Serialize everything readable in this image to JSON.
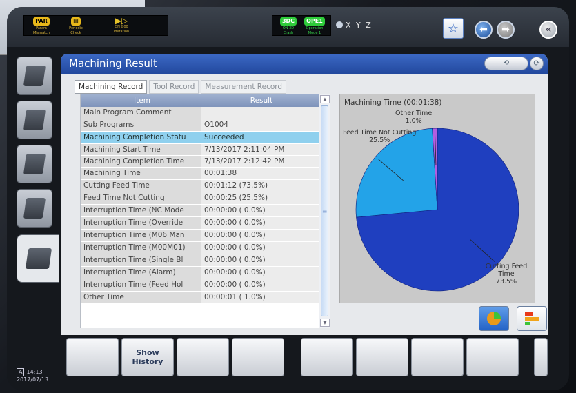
{
  "status_bar": {
    "items": [
      {
        "badge": "PAR",
        "line1": "Param",
        "line2": "Mismatch",
        "color": "#e8b81a"
      },
      {
        "badge": "",
        "line1": "Periodic",
        "line2": "Check",
        "color": "#e8b81a"
      },
      {
        "badge": "",
        "line1": "ON  G00",
        "line2": "Imitation",
        "color": "#e8b81a"
      },
      {
        "badge": "3DC",
        "line1": "ON  3D",
        "line2": "Crash",
        "color": "#2ecc3a"
      },
      {
        "badge": "OPE1",
        "line1": "Operation",
        "line2": "Mode 1",
        "color": "#2ecc3a"
      }
    ],
    "xyz_label": "X Y Z"
  },
  "panel": {
    "title": "Machining Result",
    "tabs": [
      "Machining Record",
      "Tool Record",
      "Measurement Record"
    ],
    "table": {
      "headers": [
        "Item",
        "Result"
      ],
      "rows": [
        {
          "item": "Main Program Comment",
          "result": ""
        },
        {
          "item": "Sub Programs",
          "result": "O1004"
        },
        {
          "item": "Machining Completion Statu",
          "result": "Succeeded",
          "selected": true
        },
        {
          "item": "Machining Start Time",
          "result": "7/13/2017 2:11:04 PM"
        },
        {
          "item": "Machining Completion Time",
          "result": "7/13/2017 2:12:42 PM"
        },
        {
          "item": "Machining Time",
          "result": "00:01:38"
        },
        {
          "item": "Cutting Feed Time",
          "result": "00:01:12 (73.5%)"
        },
        {
          "item": "Feed Time Not Cutting",
          "result": "00:00:25 (25.5%)"
        },
        {
          "item": "Interruption Time (NC Mode",
          "result": "00:00:00 ( 0.0%)"
        },
        {
          "item": "Interruption Time (Override",
          "result": "00:00:00 ( 0.0%)"
        },
        {
          "item": "Interruption Time (M06 Man",
          "result": "00:00:00 ( 0.0%)"
        },
        {
          "item": "Interruption Time (M00M01)",
          "result": "00:00:00 ( 0.0%)"
        },
        {
          "item": "Interruption Time (Single Bl",
          "result": "00:00:00 ( 0.0%)"
        },
        {
          "item": "Interruption Time (Alarm)",
          "result": "00:00:00 ( 0.0%)"
        },
        {
          "item": "Interruption Time (Feed Hol",
          "result": "00:00:00 ( 0.0%)"
        },
        {
          "item": "Other Time",
          "result": "00:00:01 ( 1.0%)"
        }
      ]
    }
  },
  "chart_data": {
    "type": "pie",
    "title": "Machining Time (00:01:38)",
    "slices": [
      {
        "label": "Cutting Feed Time",
        "value": 73.5,
        "pct_label": "73.5%",
        "color": "#1f3fbf"
      },
      {
        "label": "Feed Time Not Cutting",
        "value": 25.5,
        "pct_label": "25.5%",
        "color": "#23a3e8"
      },
      {
        "label": "Other Time",
        "value": 1.0,
        "pct_label": "1.0%",
        "color": "#b25ee0"
      }
    ]
  },
  "softkeys": [
    "",
    "Show\nHistory",
    "",
    "",
    "",
    "",
    "",
    "",
    ""
  ],
  "clock": {
    "badge": "A",
    "time": "14:13",
    "date": "2017/07/13"
  },
  "colors": {
    "title_bar": "#2a55b0",
    "selected_row": "#8fd0ee",
    "table_header": "#8ea2c6"
  }
}
